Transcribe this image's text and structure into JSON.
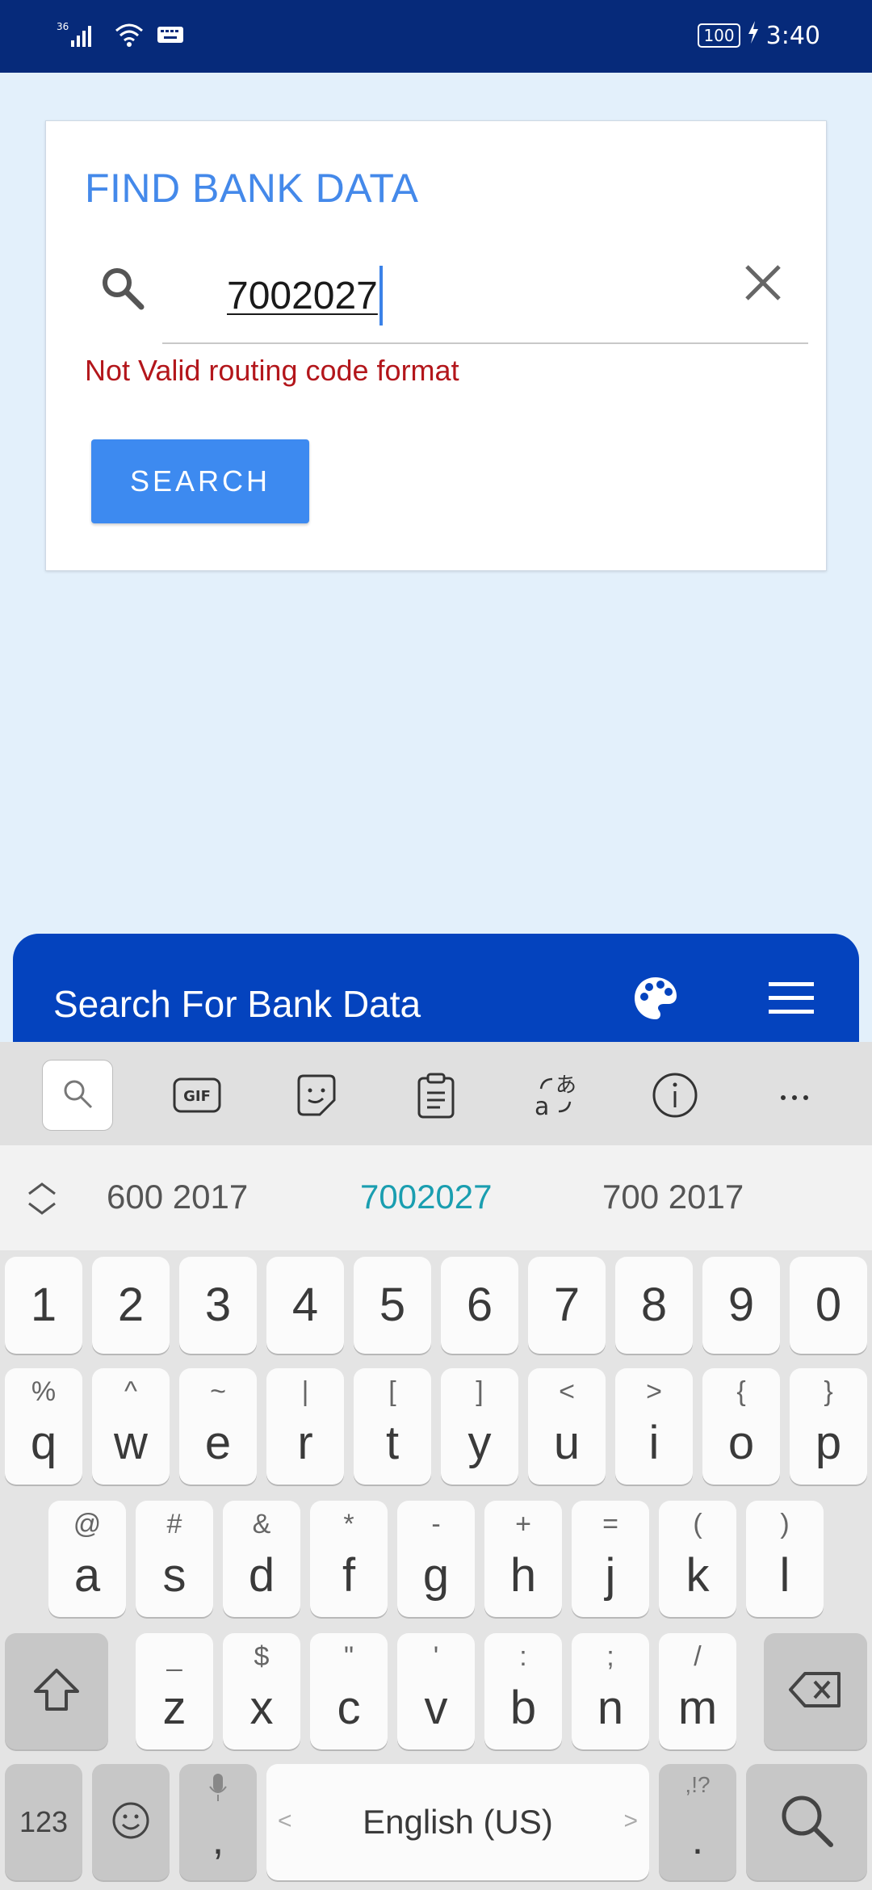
{
  "status_bar": {
    "signal_label": "36",
    "battery_label": "100",
    "time": "3:40"
  },
  "card": {
    "title": "FIND BANK DATA",
    "field_value": "7002027",
    "error": "Not Valid routing code format",
    "search_button": "SEARCH"
  },
  "appbar": {
    "title": "Search For Bank Data"
  },
  "keyboard": {
    "suggestions": [
      "600 2017",
      "7002027",
      "700 2017"
    ],
    "number_row": [
      "1",
      "2",
      "3",
      "4",
      "5",
      "6",
      "7",
      "8",
      "9",
      "0"
    ],
    "row1": [
      {
        "main": "q",
        "sub": "%"
      },
      {
        "main": "w",
        "sub": "^"
      },
      {
        "main": "e",
        "sub": "~"
      },
      {
        "main": "r",
        "sub": "|"
      },
      {
        "main": "t",
        "sub": "["
      },
      {
        "main": "y",
        "sub": "]"
      },
      {
        "main": "u",
        "sub": "<"
      },
      {
        "main": "i",
        "sub": ">"
      },
      {
        "main": "o",
        "sub": "{"
      },
      {
        "main": "p",
        "sub": "}"
      }
    ],
    "row2": [
      {
        "main": "a",
        "sub": "@"
      },
      {
        "main": "s",
        "sub": "#"
      },
      {
        "main": "d",
        "sub": "&"
      },
      {
        "main": "f",
        "sub": "*"
      },
      {
        "main": "g",
        "sub": "-"
      },
      {
        "main": "h",
        "sub": "+"
      },
      {
        "main": "j",
        "sub": "="
      },
      {
        "main": "k",
        "sub": "("
      },
      {
        "main": "l",
        "sub": ")"
      }
    ],
    "row3": [
      {
        "main": "z",
        "sub": "_"
      },
      {
        "main": "x",
        "sub": "$"
      },
      {
        "main": "c",
        "sub": "\""
      },
      {
        "main": "v",
        "sub": "'"
      },
      {
        "main": "b",
        "sub": ":"
      },
      {
        "main": "n",
        "sub": ";"
      },
      {
        "main": "m",
        "sub": "/"
      }
    ],
    "bottom": {
      "num_key": "123",
      "comma": ",",
      "space": "English (US)",
      "space_left": "<",
      "space_right": ">",
      "period": ".",
      "period_sub": ",!?"
    }
  }
}
